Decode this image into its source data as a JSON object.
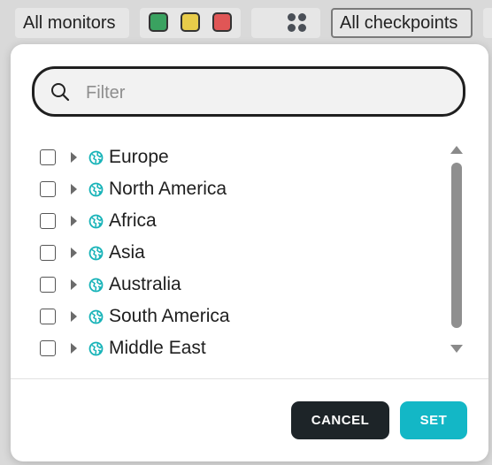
{
  "toolbar": {
    "monitors_label": "All monitors",
    "status_colors": [
      "#3aa260",
      "#e8cc4a",
      "#e05656"
    ],
    "checkpoints_label": "All checkpoints"
  },
  "filter": {
    "placeholder": "Filter",
    "value": ""
  },
  "regions": [
    {
      "label": "Europe",
      "checked": false
    },
    {
      "label": "North America",
      "checked": false
    },
    {
      "label": "Africa",
      "checked": false
    },
    {
      "label": "Asia",
      "checked": false
    },
    {
      "label": "Australia",
      "checked": false
    },
    {
      "label": "South America",
      "checked": false
    },
    {
      "label": "Middle East",
      "checked": false
    }
  ],
  "icons": {
    "region": "globe-icon",
    "expand": "caret-right-icon",
    "search": "search-icon",
    "view": "grid-icon"
  },
  "colors": {
    "globe": "#17b3b8",
    "set_button": "#13b7c6",
    "cancel_button": "#1d2428"
  },
  "actions": {
    "cancel_label": "CANCEL",
    "set_label": "SET"
  }
}
